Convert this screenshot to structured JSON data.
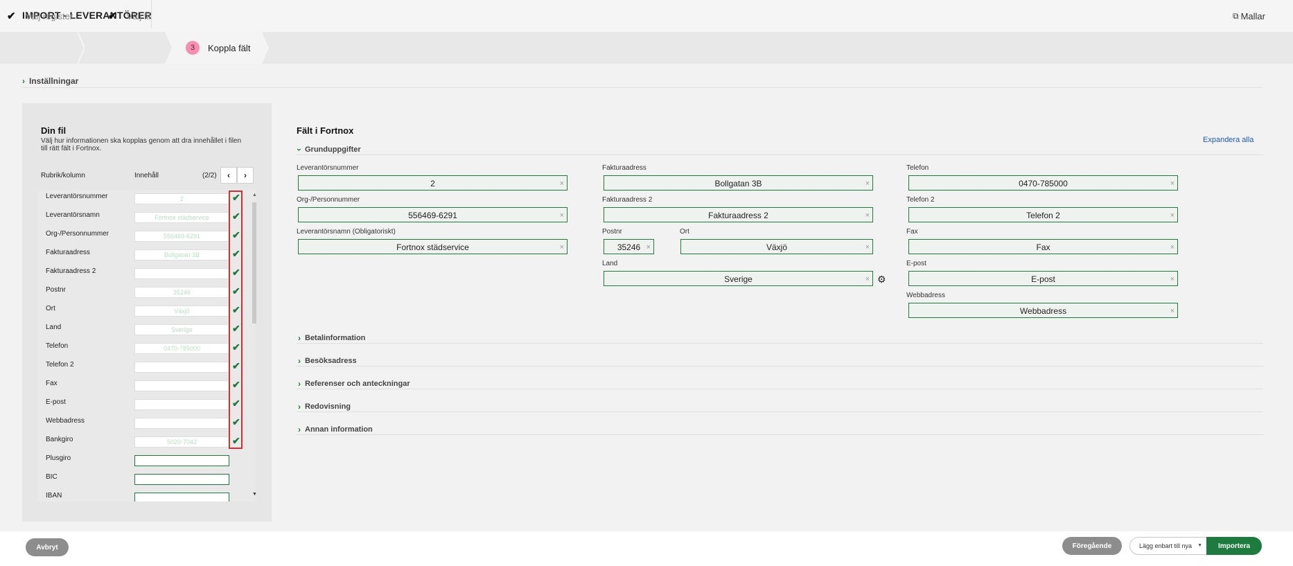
{
  "header": {
    "title": "IMPORT - LEVERANTÖRER",
    "mallar_label": "Mallar"
  },
  "steps": [
    {
      "label": "Välj register",
      "state": "done"
    },
    {
      "label": "Välj fil",
      "state": "done"
    },
    {
      "label": "Koppla fält",
      "number": "3",
      "state": "active"
    }
  ],
  "settings_label": "Inställningar",
  "left_panel": {
    "title": "Din fil",
    "description": "Välj hur informationen ska kopplas genom att dra innehållet i filen till rätt fält i Fortnox.",
    "col_header": "Rubrik/kolumn",
    "content_header": "Innehåll",
    "page_indicator": "(2/2)",
    "rows": [
      {
        "label": "Leverantörsnummer",
        "value": "2",
        "mapped": true
      },
      {
        "label": "Leverantörsnamn",
        "value": "Fortnox städservice",
        "mapped": true
      },
      {
        "label": "Org-/Personnummer",
        "value": "556469-6291",
        "mapped": true
      },
      {
        "label": "Fakturaadress",
        "value": "Bollgatan 3B",
        "mapped": true
      },
      {
        "label": "Fakturaadress 2",
        "value": "",
        "mapped": true
      },
      {
        "label": "Postnr",
        "value": "35246",
        "mapped": true
      },
      {
        "label": "Ort",
        "value": "Växjö",
        "mapped": true
      },
      {
        "label": "Land",
        "value": "Sverige",
        "mapped": true
      },
      {
        "label": "Telefon",
        "value": "0470-785000",
        "mapped": true
      },
      {
        "label": "Telefon 2",
        "value": "",
        "mapped": true
      },
      {
        "label": "Fax",
        "value": "",
        "mapped": true
      },
      {
        "label": "E-post",
        "value": "",
        "mapped": true
      },
      {
        "label": "Webbadress",
        "value": "",
        "mapped": true
      },
      {
        "label": "Bankgiro",
        "value": "5020-7042",
        "mapped": true
      },
      {
        "label": "Plusgiro",
        "value": "",
        "mapped": false
      },
      {
        "label": "BIC",
        "value": "",
        "mapped": false
      },
      {
        "label": "IBAN",
        "value": "",
        "mapped": false
      }
    ]
  },
  "right_panel": {
    "title": "Fält i Fortnox",
    "expand_all": "Expandera alla",
    "section_title": "Grunduppgifter",
    "fields": {
      "leverantorsnummer": {
        "label": "Leverantörsnummer",
        "value": "2"
      },
      "orgnr": {
        "label": "Org-/Personnummer",
        "value": "556469-6291"
      },
      "namn": {
        "label": "Leverantörsnamn (Obligatoriskt)",
        "value": "Fortnox städservice"
      },
      "fakturaadress": {
        "label": "Fakturaadress",
        "value": "Bollgatan 3B"
      },
      "fakturaadress2": {
        "label": "Fakturaadress 2",
        "value": "Fakturaadress 2"
      },
      "postnr": {
        "label": "Postnr",
        "value": "35246"
      },
      "ort": {
        "label": "Ort",
        "value": "Växjö"
      },
      "land": {
        "label": "Land",
        "value": "Sverige"
      },
      "telefon": {
        "label": "Telefon",
        "value": "0470-785000"
      },
      "telefon2": {
        "label": "Telefon 2",
        "value": "Telefon 2"
      },
      "fax": {
        "label": "Fax",
        "value": "Fax"
      },
      "epost": {
        "label": "E-post",
        "value": "E-post"
      },
      "webbadress": {
        "label": "Webbadress",
        "value": "Webbadress"
      }
    },
    "collapsed_sections": [
      "Betalinformation",
      "Besöksadress",
      "Referenser och anteckningar",
      "Redovisning",
      "Annan information"
    ]
  },
  "footer": {
    "cancel": "Avbryt",
    "previous": "Föregående",
    "import_option": "Lägg enbart till nya",
    "import": "Importera"
  },
  "colors": {
    "accent_green": "#1e7b3e",
    "step_badge_pink": "#f48fb1",
    "highlight_red": "#d32f2f",
    "link_blue": "#1a57c6"
  }
}
